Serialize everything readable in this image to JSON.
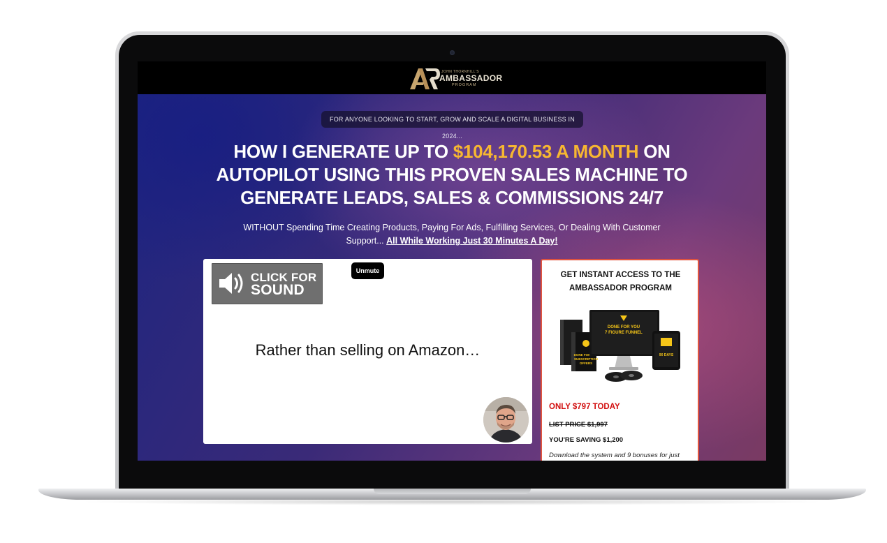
{
  "logo": {
    "small": "JOHN THORNHILL'S",
    "main": "AMBASSADOR",
    "sub": "PROGRAM"
  },
  "hero": {
    "pill": "FOR ANYONE LOOKING TO START, GROW AND SCALE A DIGITAL BUSINESS IN 2024...",
    "headline_part1": "HOW I GENERATE UP TO ",
    "headline_highlight": "$104,170.53 A MONTH",
    "headline_part2": " ON AUTOPILOT USING THIS PROVEN SALES MACHINE TO GENERATE LEADS, SALES & COMMISSIONS 24/7",
    "subhead": "WITHOUT Spending Time Creating Products, Paying For Ads, Fulfilling Services, Or Dealing With Customer Support... ",
    "subhead_link": "All While Working Just 30 Minutes A Day!"
  },
  "video": {
    "sound_line1": "CLICK FOR",
    "sound_line2": "SOUND",
    "unmute": "Unmute",
    "caption": "Rather than selling on Amazon…"
  },
  "offer": {
    "title": "GET INSTANT ACCESS TO THE AMBASSADOR PROGRAM",
    "product_monitor_line1": "DONE FOR YOU",
    "product_monitor_line2": "7 FIGURE FUNNEL",
    "product_box_line1": "DONE FOR YOU",
    "product_box_line2": "SUBSCRIPTION",
    "product_box_line3": "OFFERS",
    "product_tablet_line1": "90 DAYS",
    "price_now": "ONLY $797 TODAY",
    "price_list": "LIST PRICE $1,997",
    "saving": "YOU'RE SAVING $1,200",
    "download": "Download the system and 9 bonuses for just"
  },
  "colors": {
    "highlight": "#f7b731",
    "price_red": "#d20f0f",
    "card_border": "#e0543f"
  }
}
